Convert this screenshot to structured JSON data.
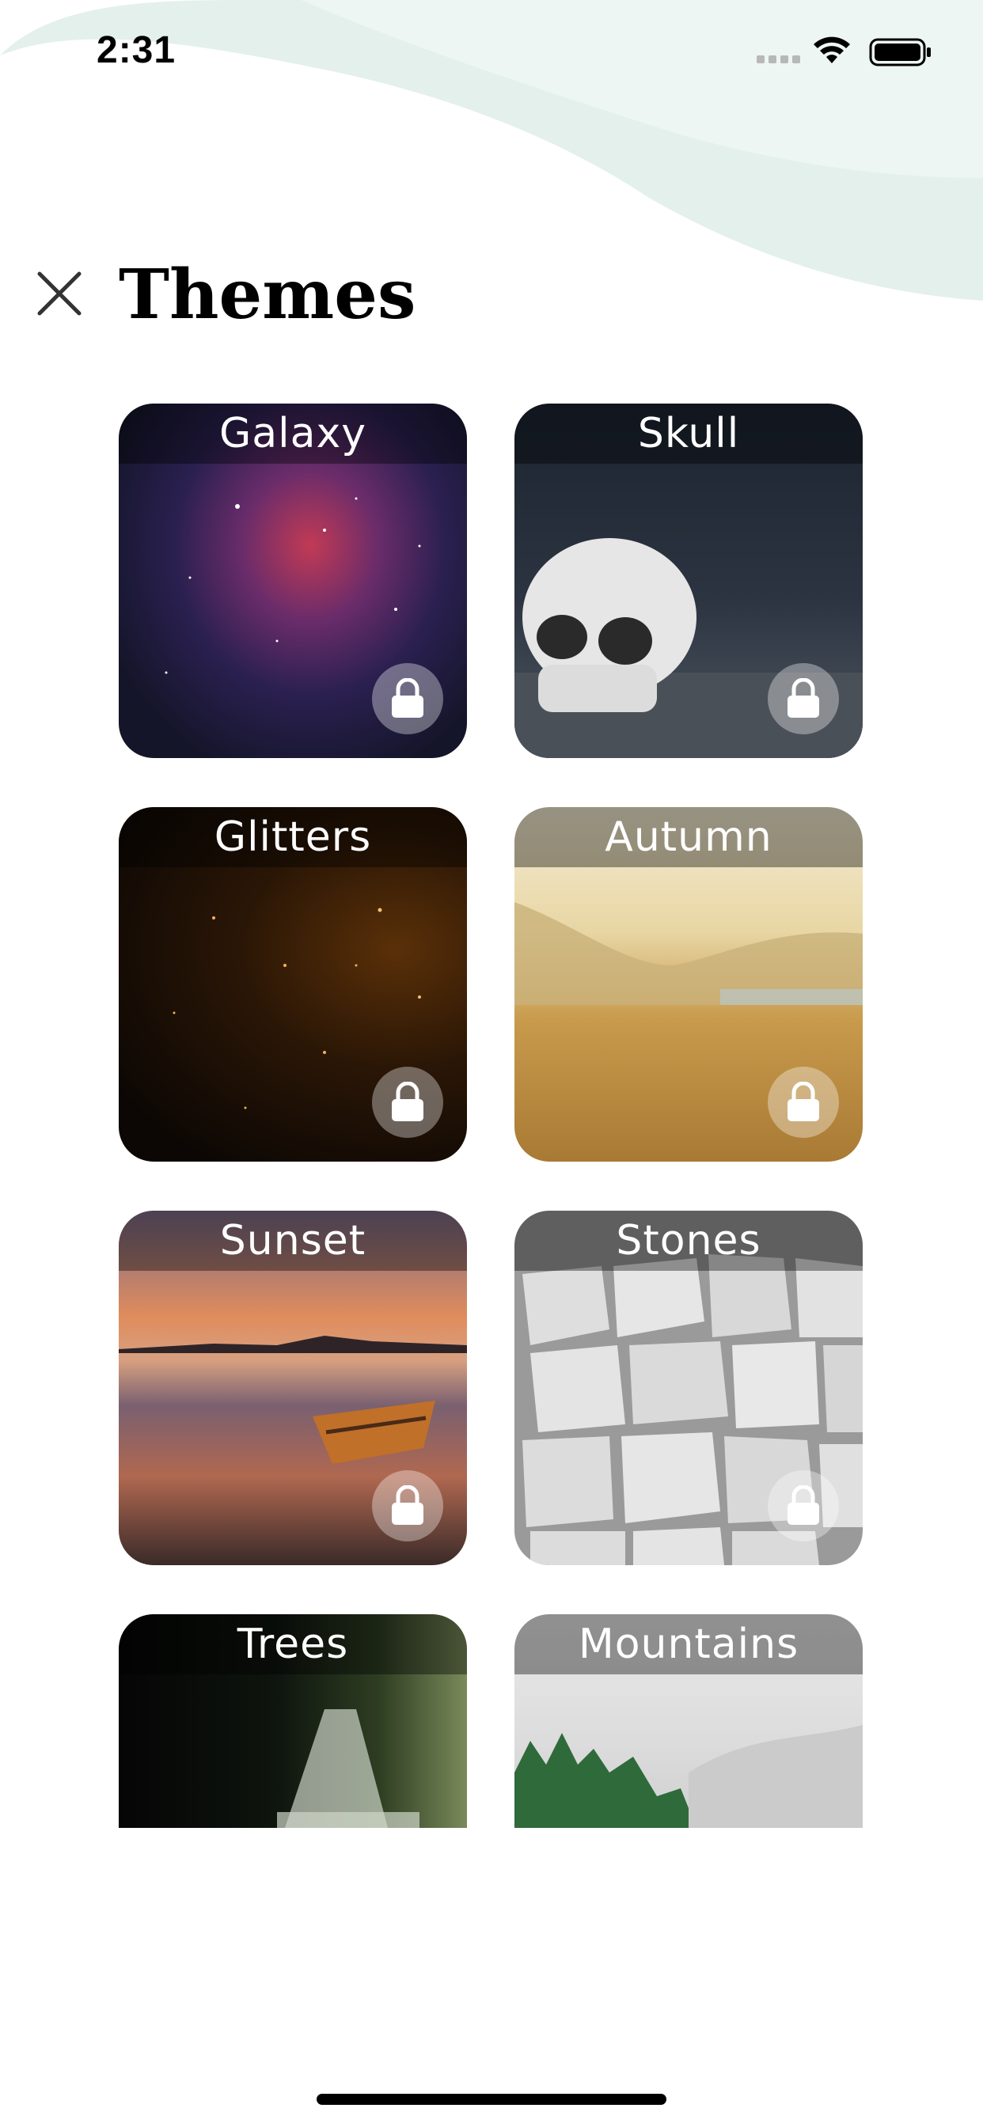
{
  "status_bar": {
    "time": "2:31",
    "icons": [
      "signal-icon",
      "wifi-icon",
      "battery-icon"
    ]
  },
  "header": {
    "title": "Themes",
    "close_icon": "close-icon"
  },
  "colors": {
    "wave": "#e0efea",
    "wave_light": "#edf6f3",
    "label_bar": "rgba(0,0,0,0.38)"
  },
  "themes": [
    {
      "name": "Galaxy",
      "locked": true
    },
    {
      "name": "Skull",
      "locked": true
    },
    {
      "name": "Glitters",
      "locked": true
    },
    {
      "name": "Autumn",
      "locked": true
    },
    {
      "name": "Sunset",
      "locked": true
    },
    {
      "name": "Stones",
      "locked": true
    },
    {
      "name": "Trees",
      "locked": false
    },
    {
      "name": "Mountains",
      "locked": false
    }
  ]
}
